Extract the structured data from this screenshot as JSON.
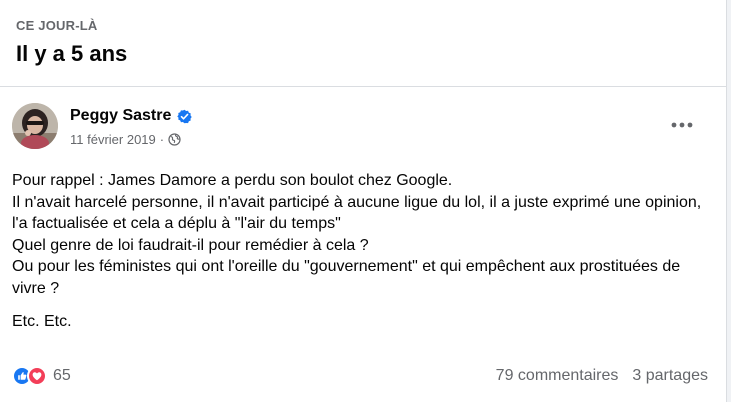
{
  "memory": {
    "kicker": "CE JOUR-LÀ",
    "headline": "Il y a 5 ans"
  },
  "post": {
    "author": "Peggy Sastre",
    "date": "11 février 2019",
    "separator": "·",
    "audience_icon": "globe-icon",
    "verified_icon": "verified-badge-icon",
    "more_icon": "more-horizontal-icon",
    "body_lines": [
      "Pour rappel : James Damore a perdu son boulot chez Google.",
      "Il n'avait harcelé personne, il n'avait participé à aucune ligue du lol, il a juste exprimé une opinion, l'a factualisée et cela a déplu à \"l'air du temps\"",
      "Quel genre de loi faudrait-il pour remédier à cela ?",
      "Ou pour les féministes qui ont l'oreille du \"gouvernement\" et qui empêchent aux prostituées de vivre ?"
    ],
    "closing": "Etc. Etc."
  },
  "footer": {
    "reactions_count": "65",
    "reaction_icons": [
      "like-icon",
      "love-icon"
    ],
    "comments": "79 commentaires",
    "shares": "3 partages"
  },
  "colors": {
    "like": "#1877f2",
    "love": "#f33e58",
    "verified": "#1877f2",
    "secondary_text": "#65676b"
  }
}
